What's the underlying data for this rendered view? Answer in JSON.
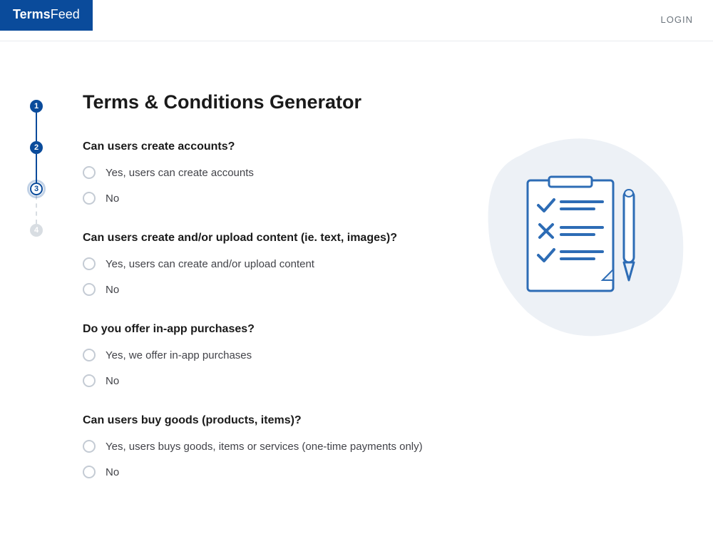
{
  "header": {
    "logo_part1": "Terms",
    "logo_part2": "Feed",
    "login": "LOGIN"
  },
  "stepper": {
    "steps": [
      "1",
      "2",
      "3",
      "4"
    ],
    "current": 3
  },
  "main": {
    "title": "Terms & Conditions Generator"
  },
  "questions": [
    {
      "q": "Can users create accounts?",
      "opts": [
        "Yes, users can create accounts",
        "No"
      ]
    },
    {
      "q": "Can users create and/or upload content (ie. text, images)?",
      "opts": [
        "Yes, users can create and/or upload content",
        "No"
      ]
    },
    {
      "q": "Do you offer in-app purchases?",
      "opts": [
        "Yes, we offer in-app purchases",
        "No"
      ]
    },
    {
      "q": "Can users buy goods (products, items)?",
      "opts": [
        "Yes, users buys goods, items or services (one-time payments only)",
        "No"
      ]
    }
  ]
}
